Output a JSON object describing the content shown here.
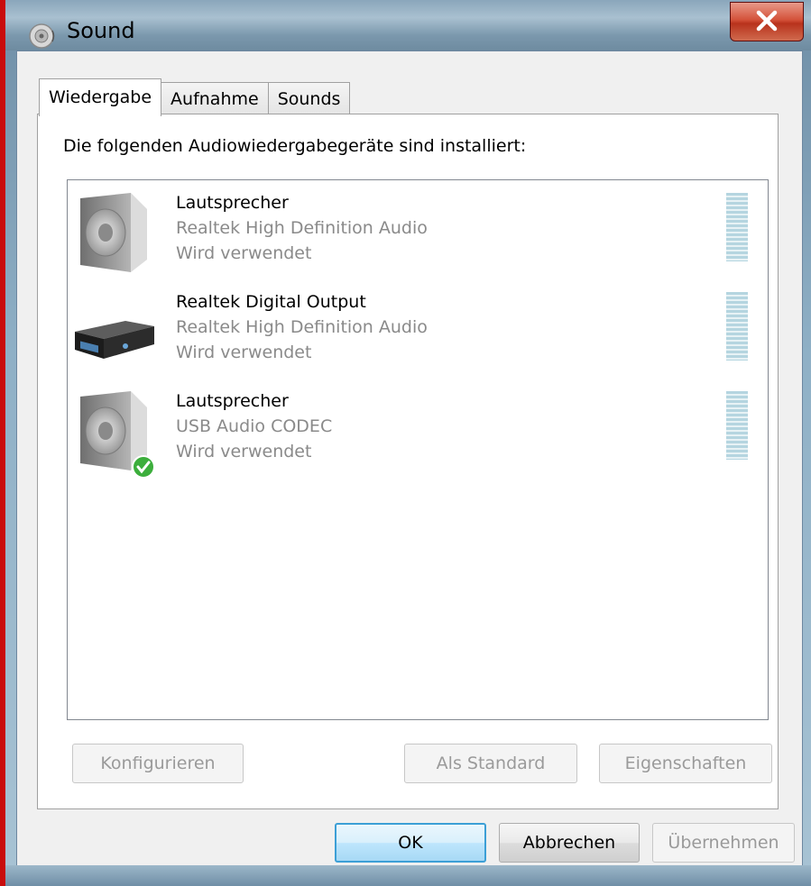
{
  "window": {
    "title": "Sound",
    "title_icon": "speaker-icon",
    "close_icon": "close-icon"
  },
  "tabs": [
    {
      "label": "Wiedergabe",
      "active": true
    },
    {
      "label": "Aufnahme",
      "active": false
    },
    {
      "label": "Sounds",
      "active": false
    }
  ],
  "panel": {
    "instruction": "Die folgenden Audiowiedergabegeräte sind installiert:"
  },
  "devices": [
    {
      "name": "Lautsprecher",
      "driver": "Realtek High Definition Audio",
      "status": "Wird verwendet",
      "icon": "speaker-icon",
      "is_default": false
    },
    {
      "name": "Realtek Digital Output",
      "driver": "Realtek High Definition Audio",
      "status": "Wird verwendet",
      "icon": "digital-output-icon",
      "is_default": false
    },
    {
      "name": "Lautsprecher",
      "driver": "USB Audio CODEC",
      "status": "Wird verwendet",
      "icon": "speaker-icon",
      "is_default": true
    }
  ],
  "panel_buttons": {
    "configure": "Konfigurieren",
    "set_default": "Als Standard",
    "properties": "Eigenschaften"
  },
  "dialog_buttons": {
    "ok": "OK",
    "cancel": "Abbrechen",
    "apply": "Übernehmen"
  },
  "colors": {
    "accent": "#3c9fd6",
    "disabled_text": "#9a9a9a",
    "meter": "#b5d5e0",
    "default_check": "#3cae3c"
  }
}
